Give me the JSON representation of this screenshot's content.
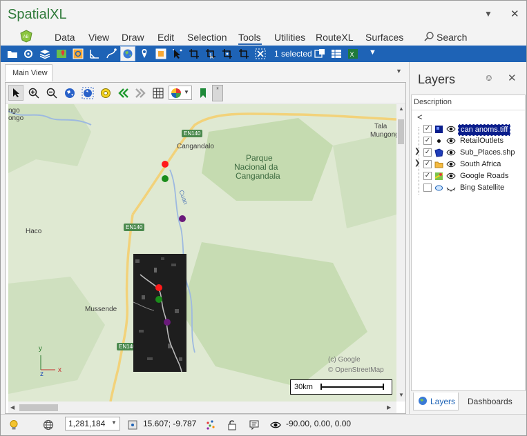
{
  "app": {
    "title": "SpatialXL"
  },
  "menu": {
    "items": [
      "Data",
      "View",
      "Draw",
      "Edit",
      "Selection",
      "Tools",
      "Utilities",
      "RouteXL",
      "Surfaces"
    ],
    "search_label": "Search",
    "active": "Tools"
  },
  "ribbon": {
    "selected_label": "1 selected"
  },
  "document": {
    "tab_label": "Main View"
  },
  "map": {
    "labels": {
      "top_left_1": "ngo",
      "top_left_2": "ongo",
      "cangandalo": "Cangandalo",
      "parque_1": "Parque",
      "parque_2": "Nacional da",
      "parque_3": "Cangandala",
      "tala_1": "Tala",
      "tala_2": "Mungongo",
      "haco": "Haco",
      "mussende": "Mussende",
      "river": "Cuan",
      "copyright_1": "(c) Google",
      "copyright_2": "© OpenStreetMap"
    },
    "roads": {
      "en140_top": "EN140",
      "en140_mid": "EN140",
      "en140_bottom": "EN140"
    },
    "axes": {
      "y": "y",
      "x": "x",
      "z": "z"
    },
    "scale_bar_label": "30km",
    "colors": {
      "point_red": "#ff1a1a",
      "point_green": "#1a8c1a",
      "point_purple": "#6a1a7a"
    }
  },
  "layers_panel": {
    "title": "Layers",
    "column_header": "Description",
    "back_glyph": "<",
    "layers": [
      {
        "name": "can anoms.tiff",
        "checked": true,
        "selected": true,
        "expandable": false,
        "icon": "raster-icon"
      },
      {
        "name": "RetailOutlets",
        "checked": true,
        "selected": false,
        "expandable": false,
        "icon": "point-icon"
      },
      {
        "name": "Sub_Places.shp",
        "checked": true,
        "selected": false,
        "expandable": true,
        "icon": "polygon-icon"
      },
      {
        "name": "South Africa",
        "checked": true,
        "selected": false,
        "expandable": true,
        "icon": "folder-icon"
      },
      {
        "name": "Google Roads",
        "checked": true,
        "selected": false,
        "expandable": false,
        "icon": "google-roads-icon"
      },
      {
        "name": "Bing Satellite",
        "checked": false,
        "selected": false,
        "expandable": false,
        "icon": "bing-icon"
      }
    ],
    "tabs": {
      "layers": "Layers",
      "dashboards": "Dashboards"
    }
  },
  "status": {
    "scale": "1,281,184",
    "coordinates": "15.607; -9.787",
    "rotation": "-90.00, 0.00, 0.00"
  }
}
